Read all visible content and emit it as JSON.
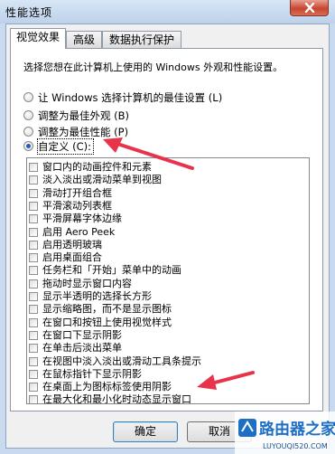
{
  "window": {
    "title": "性能选项"
  },
  "tabs": [
    {
      "label": "视觉效果",
      "active": true
    },
    {
      "label": "高级",
      "active": false
    },
    {
      "label": "数据执行保护",
      "active": false
    }
  ],
  "description": "选择您想在此计算机上使用的 Windows 外观和性能设置。",
  "radios": [
    {
      "label": "让 Windows 选择计算机的最佳设置 (L)",
      "checked": false
    },
    {
      "label": "调整为最佳外观 (B)",
      "checked": false
    },
    {
      "label": "调整为最佳性能 (P)",
      "checked": false
    },
    {
      "label": "自定义 (C):",
      "checked": true
    }
  ],
  "options": [
    {
      "label": "窗口内的动画控件和元素",
      "checked": false
    },
    {
      "label": "淡入淡出或滑动菜单到视图",
      "checked": false
    },
    {
      "label": "滑动打开组合框",
      "checked": false
    },
    {
      "label": "平滑滚动列表框",
      "checked": false
    },
    {
      "label": "平滑屏幕字体边缘",
      "checked": false
    },
    {
      "label": "启用 Aero Peek",
      "checked": false
    },
    {
      "label": "启用透明玻璃",
      "checked": false
    },
    {
      "label": "启用桌面组合",
      "checked": false
    },
    {
      "label": "任务栏和「开始」菜单中的动画",
      "checked": false
    },
    {
      "label": "拖动时显示窗口内容",
      "checked": false
    },
    {
      "label": "显示半透明的选择长方形",
      "checked": false
    },
    {
      "label": "显示缩略图，而不是显示图标",
      "checked": false
    },
    {
      "label": "在窗口和按钮上使用视觉样式",
      "checked": false
    },
    {
      "label": "在窗口下显示阴影",
      "checked": false
    },
    {
      "label": "在单击后淡出菜单",
      "checked": false
    },
    {
      "label": "在视图中淡入淡出或滑动工具条提示",
      "checked": false
    },
    {
      "label": "在鼠标指针下显示阴影",
      "checked": false
    },
    {
      "label": "在桌面上为图标标签使用阴影",
      "checked": false
    },
    {
      "label": "在最大化和最小化时动态显示窗口",
      "checked": false
    }
  ],
  "buttons": {
    "ok": "确定",
    "cancel": "取消"
  },
  "watermark": {
    "brand": "路由器之家",
    "url": "LUYOUQI520.COM"
  },
  "colors": {
    "annotation_arrow": "#e8334a",
    "checked_radio": "#1e5fb7",
    "close_button": "#c8452f"
  }
}
